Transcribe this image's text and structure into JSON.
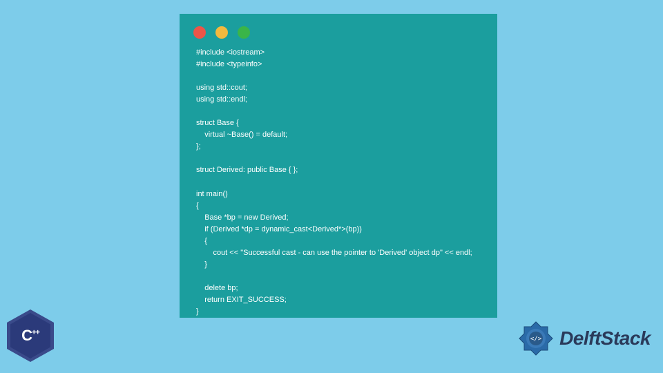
{
  "window": {
    "dots": [
      "red",
      "yellow",
      "green"
    ]
  },
  "code": "#include <iostream>\n#include <typeinfo>\n\nusing std::cout;\nusing std::endl;\n\nstruct Base {\n    virtual ~Base() = default;\n};\n\nstruct Derived: public Base { };\n\nint main()\n{\n    Base *bp = new Derived;\n    if (Derived *dp = dynamic_cast<Derived*>(bp))\n    {\n        cout << \"Successful cast - can use the pointer to 'Derived' object dp\" << endl;\n    }\n\n    delete bp;\n    return EXIT_SUCCESS;\n}",
  "cpp_badge": {
    "label": "C",
    "plus": "++"
  },
  "brand": {
    "name": "DelftStack"
  }
}
